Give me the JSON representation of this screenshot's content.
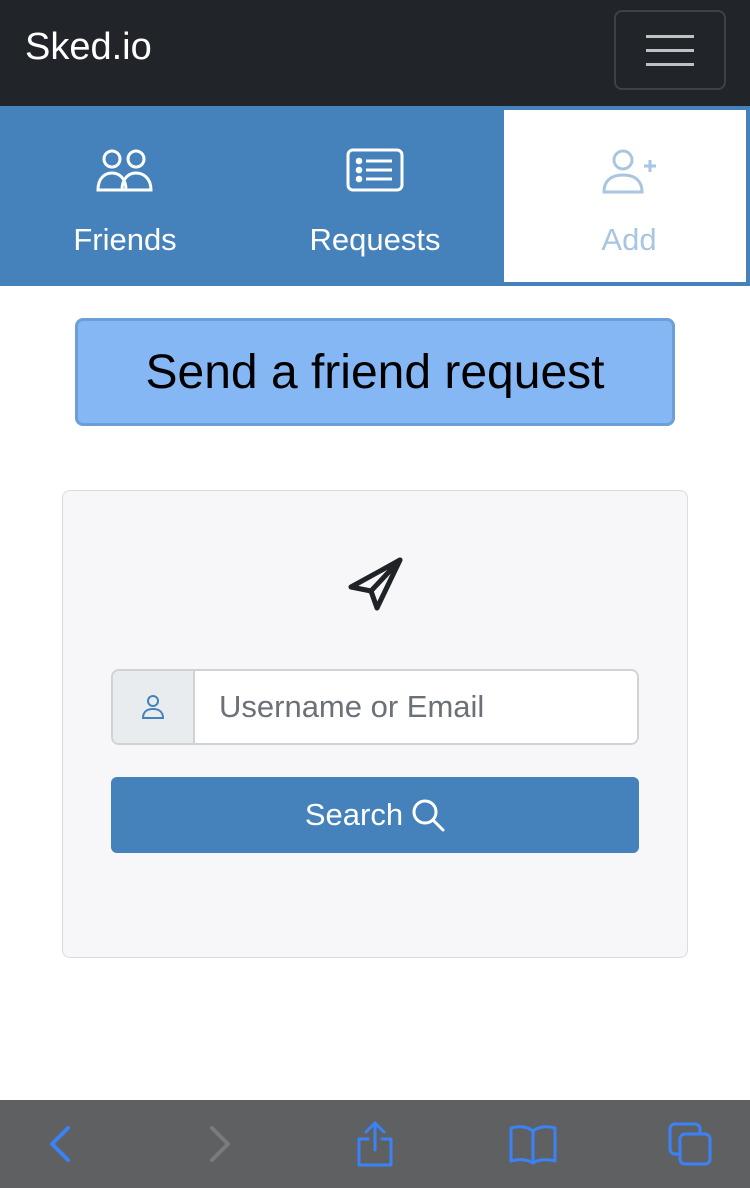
{
  "navbar": {
    "brand": "Sked.io",
    "menu_icon": "hamburger-icon"
  },
  "tabs": [
    {
      "label": "Friends",
      "icon": "users-icon",
      "active": false
    },
    {
      "label": "Requests",
      "icon": "list-icon",
      "active": false
    },
    {
      "label": "Add",
      "icon": "user-plus-icon",
      "active": true
    }
  ],
  "main": {
    "heading": "Send a friend request",
    "card": {
      "icon": "paper-plane-icon",
      "input": {
        "placeholder": "Username or Email",
        "value": "",
        "addon_icon": "user-icon"
      },
      "search_label": "Search",
      "search_icon": "magnifier-icon"
    }
  },
  "browser_toolbar": {
    "items": [
      "back-icon",
      "forward-icon",
      "share-icon",
      "bookmarks-icon",
      "tabs-icon"
    ]
  },
  "colors": {
    "navbar_bg": "#212529",
    "tabbar_bg": "#4582bb",
    "heading_bg": "#85b7f5",
    "button_bg": "#4582bb",
    "toolbar_bg": "#5f6062",
    "toolbar_accent": "#3b82f6"
  }
}
